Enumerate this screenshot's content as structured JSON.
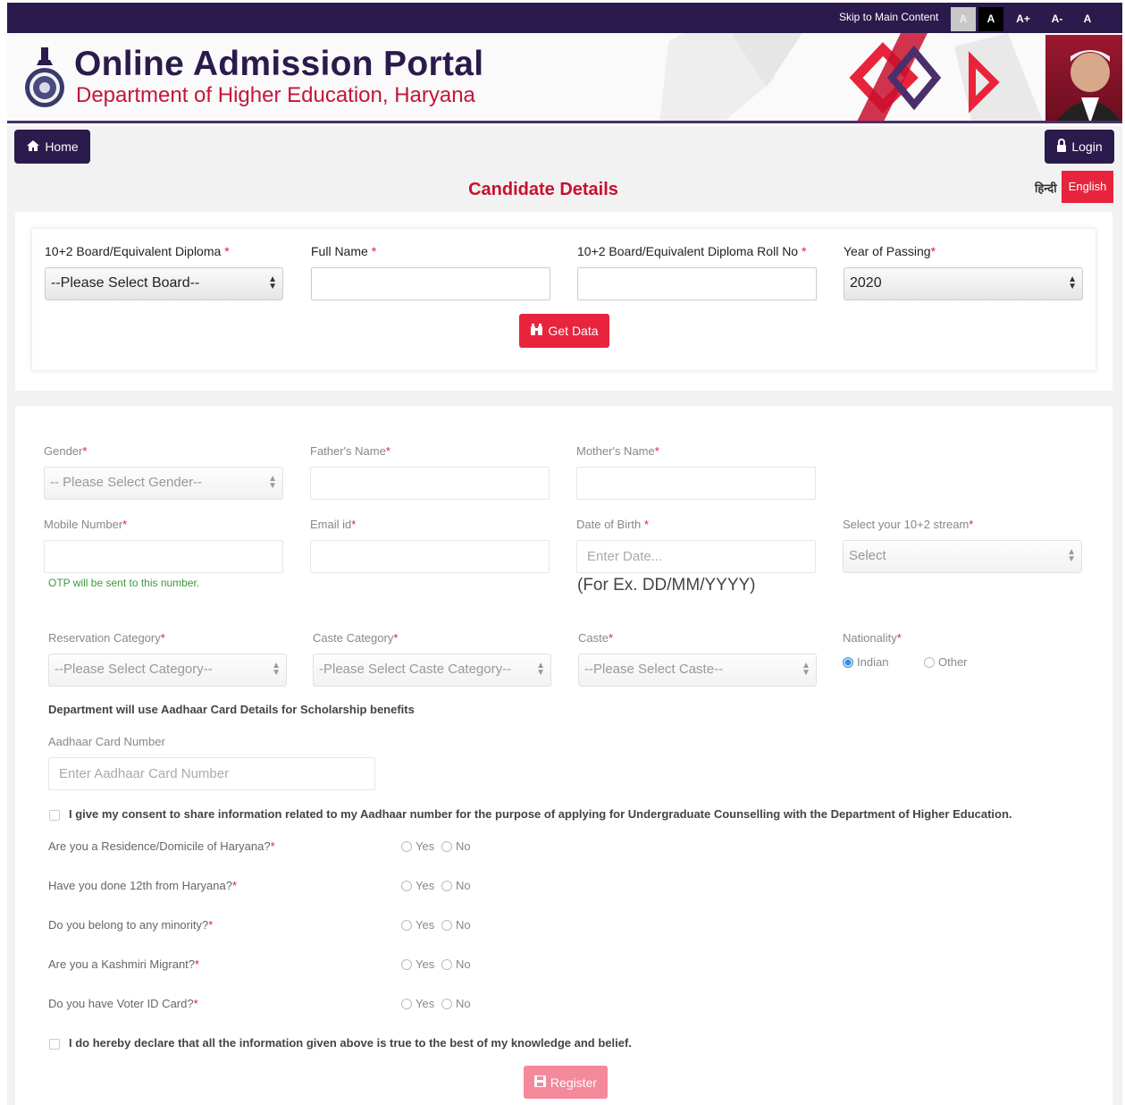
{
  "topbar": {
    "skip_label": "Skip to Main Content",
    "font_buttons": [
      "A",
      "A",
      "A+",
      "A-",
      "A"
    ]
  },
  "header": {
    "title": "Online Admission Portal",
    "subtitle": "Department of Higher Education, Haryana"
  },
  "nav": {
    "home_label": "Home",
    "login_label": "Login",
    "hindi_label": "हिन्दी",
    "english_label": "English"
  },
  "page_title": "Candidate Details",
  "board_section": {
    "board_label": "10+2 Board/Equivalent Diploma",
    "board_value": "--Please Select Board--",
    "fullname_label": "Full Name",
    "fullname_value": "",
    "rollno_label": "10+2 Board/Equivalent Diploma Roll No",
    "rollno_value": "",
    "year_label": "Year of Passing",
    "year_value": "2020",
    "get_data_label": "Get Data"
  },
  "details": {
    "gender_label": "Gender",
    "gender_value": "-- Please Select Gender--",
    "father_label": "Father's Name",
    "mother_label": "Mother's Name",
    "mobile_label": "Mobile Number",
    "email_label": "Email id",
    "dob_label": "Date of Birth",
    "dob_placeholder": "Enter Date...",
    "stream_label": "Select your 10+2 stream",
    "stream_value": "Select",
    "otp_note": "OTP will be sent to this number.",
    "dob_hint": "(For Ex. DD/MM/YYYY)",
    "reservation_label": "Reservation Category",
    "reservation_value": "--Please Select Category--",
    "caste_category_label": "Caste Category",
    "caste_category_value": "-Please Select Caste Category--",
    "caste_label": "Caste",
    "caste_value": "--Please Select Caste--",
    "nationality_label": "Nationality",
    "nationality_options": [
      "Indian",
      "Other"
    ],
    "nationality_selected": "Indian",
    "aadhaar_notice": "Department will use Aadhaar Card Details for Scholarship benefits",
    "aadhaar_label": "Aadhaar Card Number",
    "aadhaar_placeholder": "Enter Aadhaar Card Number",
    "consent_text": "I give my consent to share information related to my Aadhaar number for the purpose of applying for Undergraduate Counselling with the Department of Higher Education.",
    "questions": [
      {
        "text": "Are you a Residence/Domicile of Haryana?"
      },
      {
        "text": "Have you done 12th from Haryana?"
      },
      {
        "text": "Do you belong to any minority?"
      },
      {
        "text": "Are you a Kashmiri Migrant?"
      },
      {
        "text": "Do you have Voter ID Card?"
      }
    ],
    "yes_label": "Yes",
    "no_label": "No",
    "declaration_text": "I do hereby declare that all the information given above is true to the best of my knowledge and belief.",
    "register_label": "Register"
  },
  "colors": {
    "brand_dark": "#2b1b4c",
    "accent_red": "#e8243c"
  }
}
